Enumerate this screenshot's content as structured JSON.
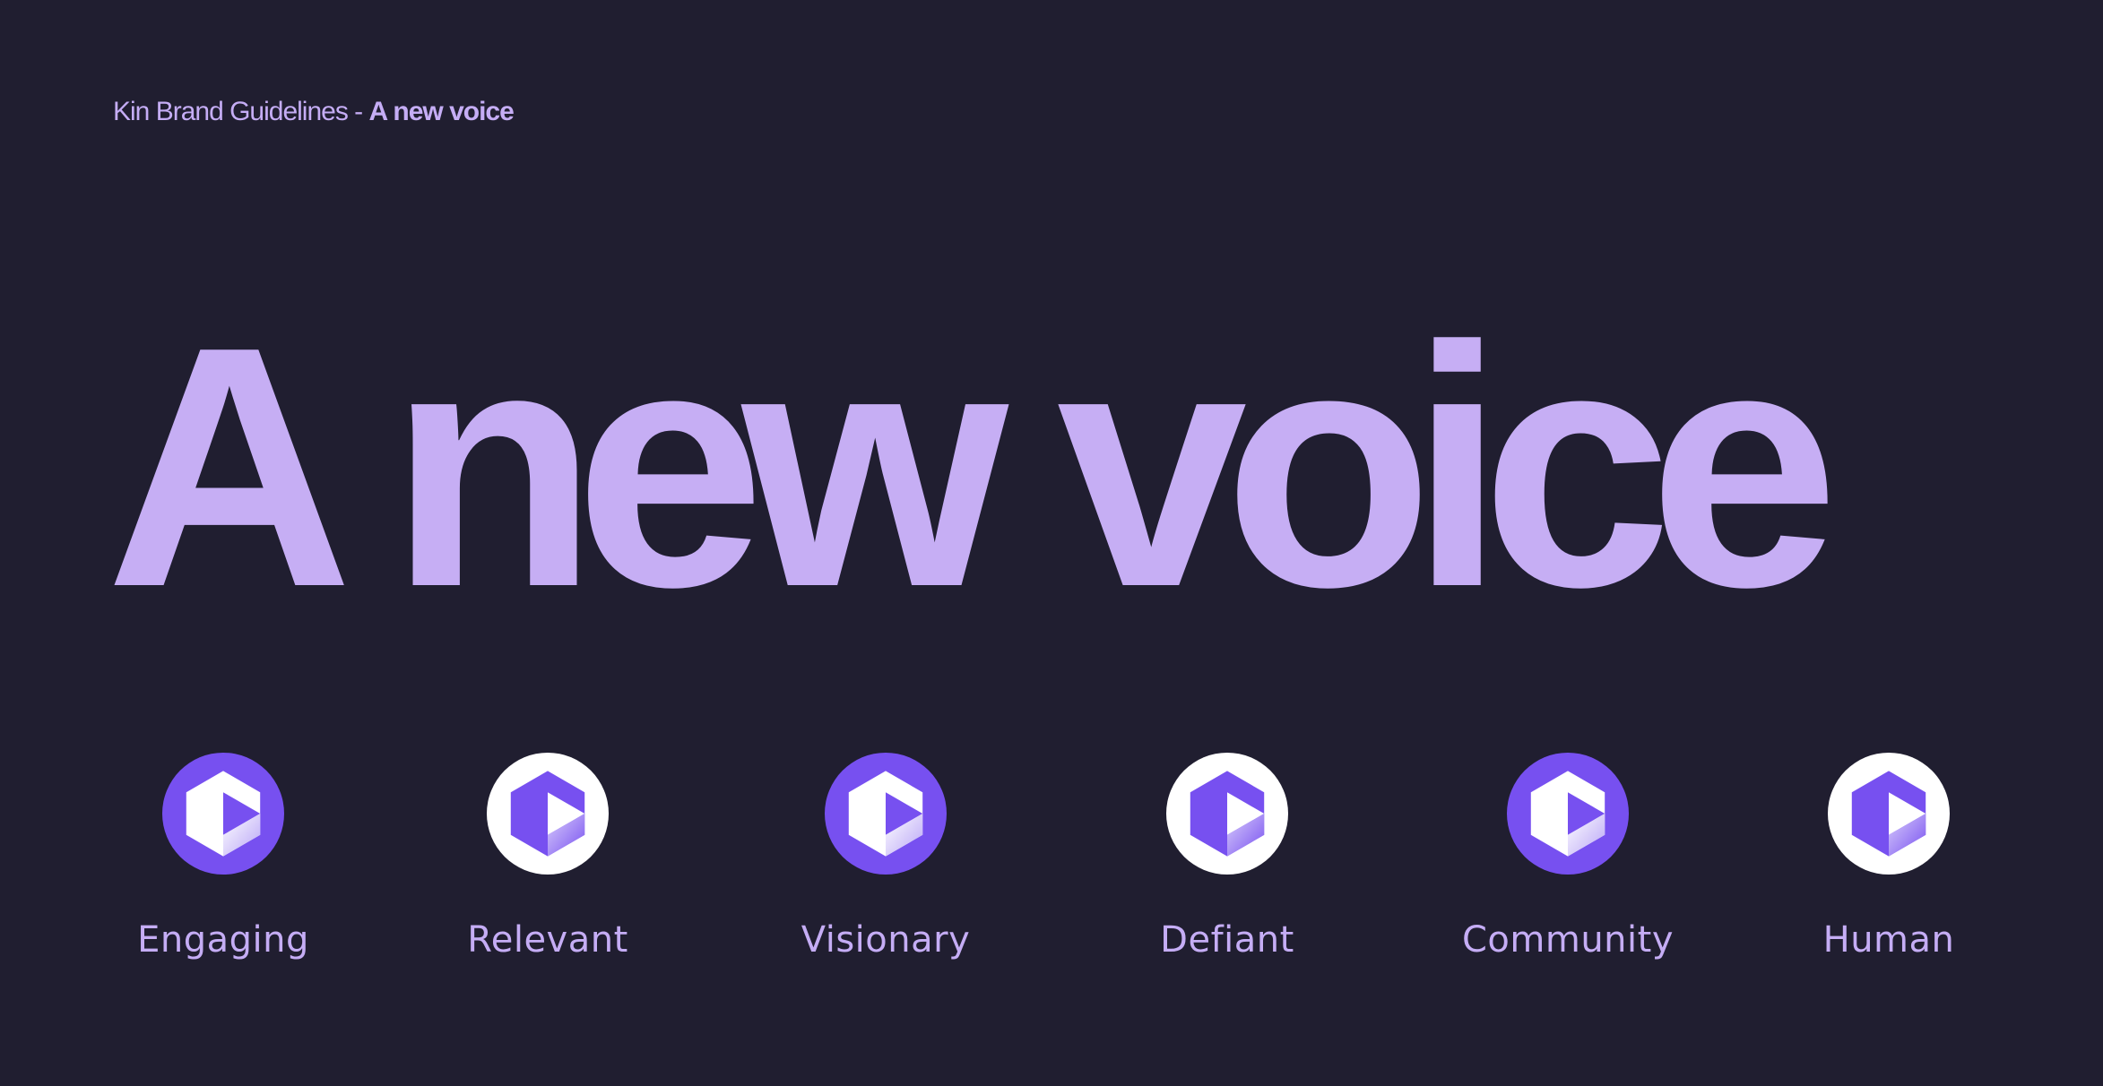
{
  "header": {
    "prefix": "Kin Brand Guidelines - ",
    "emphasis": "A new voice"
  },
  "hero": {
    "title": "A new voice"
  },
  "colors": {
    "background": "#201e30",
    "lavender": "#c6aef4",
    "purple": "#7750f0",
    "white": "#ffffff"
  },
  "values": [
    {
      "label": "Engaging",
      "icon": "kin-logo-icon",
      "variant": "purple"
    },
    {
      "label": "Relevant",
      "icon": "kin-logo-icon",
      "variant": "white"
    },
    {
      "label": "Visionary",
      "icon": "kin-logo-icon",
      "variant": "purple"
    },
    {
      "label": "Defiant",
      "icon": "kin-logo-icon",
      "variant": "white"
    },
    {
      "label": "Community",
      "icon": "kin-logo-icon",
      "variant": "purple"
    },
    {
      "label": "Human",
      "icon": "kin-logo-icon",
      "variant": "white"
    }
  ]
}
